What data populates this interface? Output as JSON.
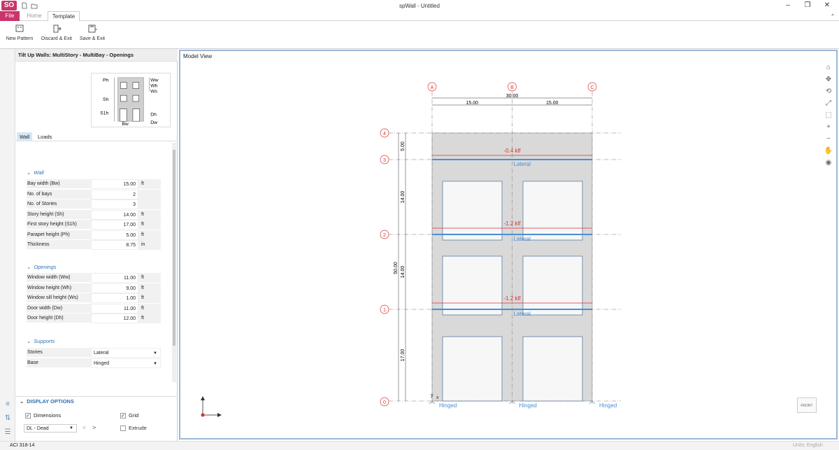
{
  "app": {
    "logo": "SO",
    "title": "spWall - Untitled"
  },
  "tabs": {
    "file": "File",
    "home": "Home",
    "template": "Template"
  },
  "ribbon": {
    "new_pattern": "New Pattern",
    "discard_exit": "Discard & Exit",
    "save_exit": "Save & Exit"
  },
  "panel": {
    "title": "Tilt Up Walls:   MultiStory - MultiBay - Openings",
    "preview_labels": {
      "ph": "Ph",
      "sh": "Sh",
      "s1h": "S1h",
      "ww": "Ww",
      "wh": "Wh",
      "ws": "Ws",
      "dh": "Dh",
      "dw": "Dw",
      "bw": "Bw"
    },
    "subtabs": {
      "wall": "Wall",
      "loads": "Loads"
    },
    "wall_section": "Wall",
    "wall_rows": [
      {
        "label": "Bay width (Bw)",
        "value": "15.00",
        "unit": "ft"
      },
      {
        "label": "No. of bays",
        "value": "2",
        "unit": ""
      },
      {
        "label": "No. of Stories",
        "value": "3",
        "unit": ""
      },
      {
        "label": "Story height (Sh)",
        "value": "14.00",
        "unit": "ft"
      },
      {
        "label": "First story height (S1h)",
        "value": "17.00",
        "unit": "ft"
      },
      {
        "label": "Parapet height (Ph)",
        "value": "5.00",
        "unit": "ft"
      },
      {
        "label": "Thickness",
        "value": "8.75",
        "unit": "in"
      }
    ],
    "openings_section": "Openings",
    "openings_rows": [
      {
        "label": "Window width (Ww)",
        "value": "11.00",
        "unit": "ft"
      },
      {
        "label": "Window height (Wh)",
        "value": "9.00",
        "unit": "ft"
      },
      {
        "label": "Window sill height (Ws)",
        "value": "1.00",
        "unit": "ft"
      },
      {
        "label": "Door width (Dw)",
        "value": "11.00",
        "unit": "ft"
      },
      {
        "label": "Door height (Dh)",
        "value": "12.00",
        "unit": "ft"
      }
    ],
    "supports_section": "Supports",
    "supports_rows": [
      {
        "label": "Stories",
        "value": "Lateral"
      },
      {
        "label": "Base",
        "value": "Hinged"
      }
    ],
    "display_options": "DISPLAY OPTIONS",
    "dimensions": "Dimensions",
    "grid": "Grid",
    "extrude": "Extrude",
    "load_case": "DL - Dead"
  },
  "model": {
    "label": "Model View",
    "col_labels": [
      "A",
      "B",
      "C"
    ],
    "row_labels": [
      "4",
      "3",
      "2",
      "1",
      "0"
    ],
    "top_total": "30.00",
    "top_spans": [
      "15.00",
      "15.00"
    ],
    "left_dims": [
      "5.00",
      "14.00",
      "14.00",
      "17.00"
    ],
    "total_height": "50.00",
    "loads": [
      "-0.4 klf",
      "-1.2 klf",
      "-1.2 klf"
    ],
    "lateral": "Lateral",
    "hinged": "Hinged",
    "front": "FRONT",
    "axis_y": "y",
    "axis_x": "x"
  },
  "status": {
    "code": "ACI 318-14",
    "units": "Units: English"
  },
  "colors": {
    "accent": "#c9356a",
    "link": "#2f6fb4",
    "load": "#e03030",
    "support": "#4a8fd6",
    "wall": "#d9d9d9"
  }
}
